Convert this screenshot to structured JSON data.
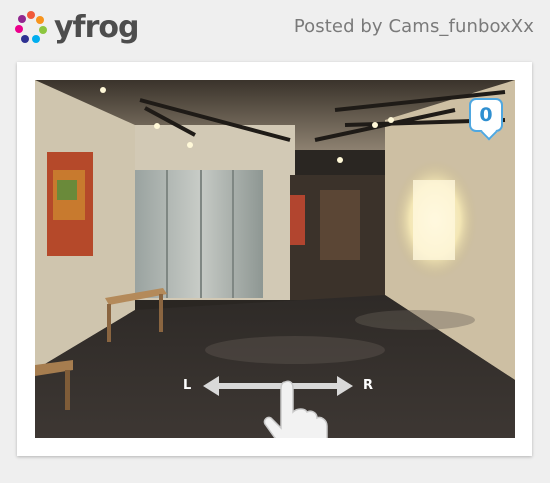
{
  "header": {
    "logo_text": "yfrog",
    "posted_by": "Posted by Cams_funboxXx"
  },
  "photo": {
    "comment_count": "0",
    "swipe_left_label": "L",
    "swipe_right_label": "R"
  },
  "colors": {
    "accent_blue": "#4fa7e0",
    "logo_text": "#4d4d4d"
  },
  "icons": [
    "yfrog-logo-icon",
    "comment-bubble-icon",
    "swipe-arrow-icon",
    "hand-pointer-icon"
  ]
}
